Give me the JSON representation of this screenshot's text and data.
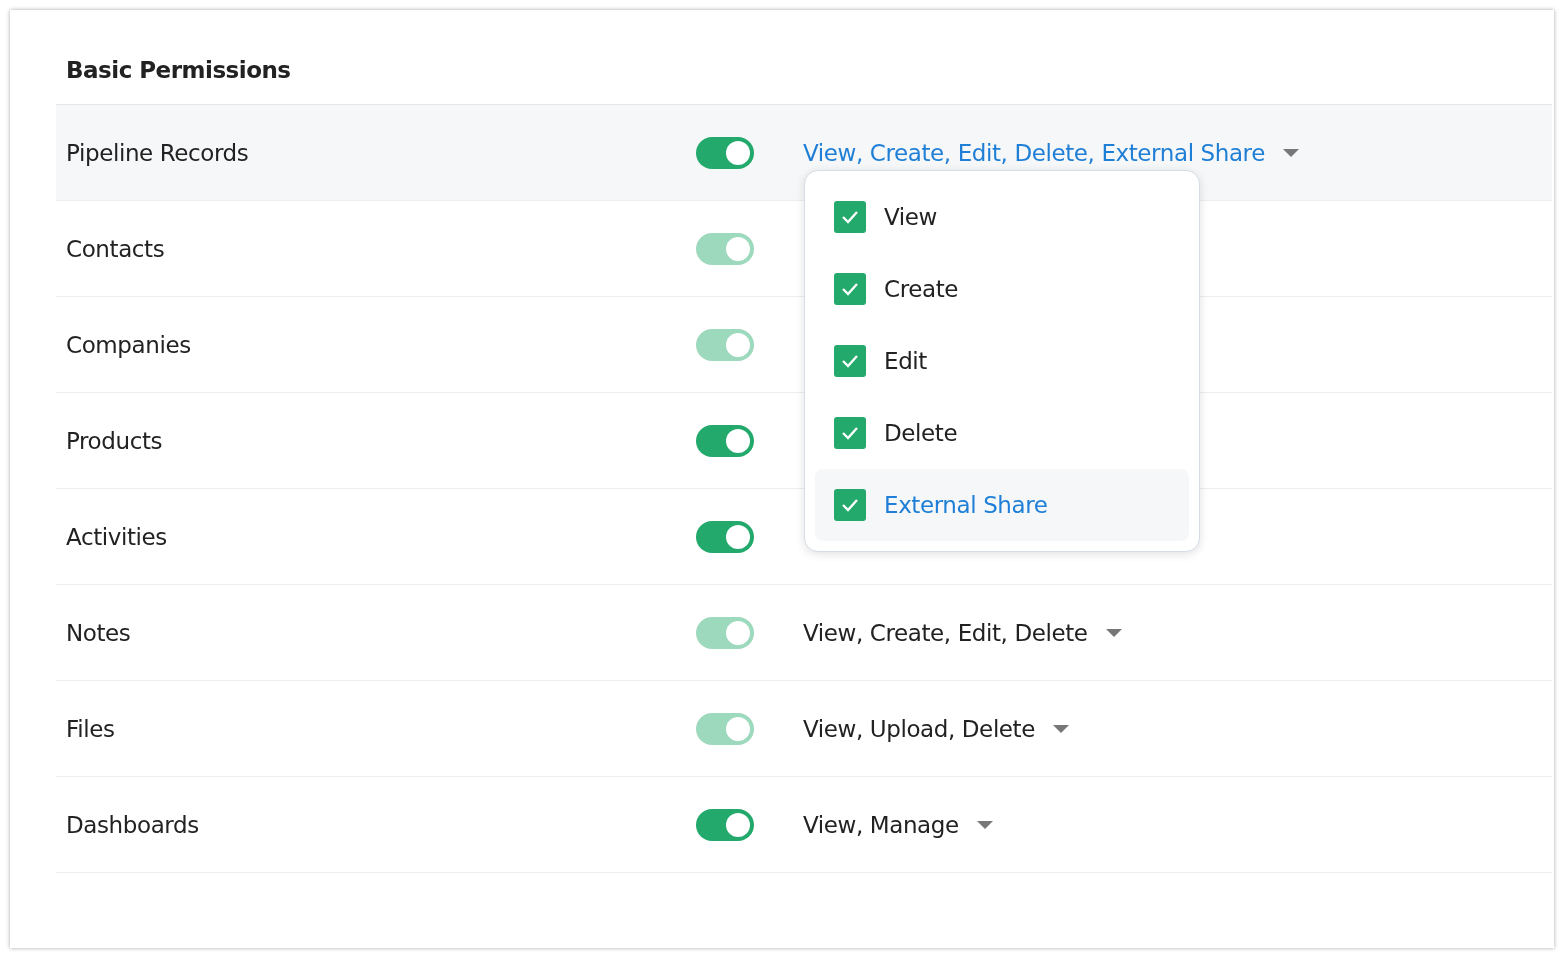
{
  "title": "Basic Permissions",
  "rows": [
    {
      "name": "Pipeline Records",
      "toggle": {
        "on": true,
        "disabled": false
      },
      "permissions": "View, Create, Edit, Delete, External Share",
      "dropdown": {
        "options": [
          {
            "label": "View",
            "checked": true,
            "selected": false
          },
          {
            "label": "Create",
            "checked": true,
            "selected": false
          },
          {
            "label": "Edit",
            "checked": true,
            "selected": false
          },
          {
            "label": "Delete",
            "checked": true,
            "selected": false
          },
          {
            "label": "External Share",
            "checked": true,
            "selected": true
          }
        ]
      }
    },
    {
      "name": "Contacts",
      "toggle": {
        "on": true,
        "disabled": true
      }
    },
    {
      "name": "Companies",
      "toggle": {
        "on": true,
        "disabled": true
      }
    },
    {
      "name": "Products",
      "toggle": {
        "on": true,
        "disabled": false
      }
    },
    {
      "name": "Activities",
      "toggle": {
        "on": true,
        "disabled": false
      }
    },
    {
      "name": "Notes",
      "toggle": {
        "on": true,
        "disabled": true
      },
      "permissions": "View, Create, Edit, Delete"
    },
    {
      "name": "Files",
      "toggle": {
        "on": true,
        "disabled": true
      },
      "permissions": "View, Upload, Delete"
    },
    {
      "name": "Dashboards",
      "toggle": {
        "on": true,
        "disabled": false
      },
      "permissions": "View, Manage"
    }
  ]
}
